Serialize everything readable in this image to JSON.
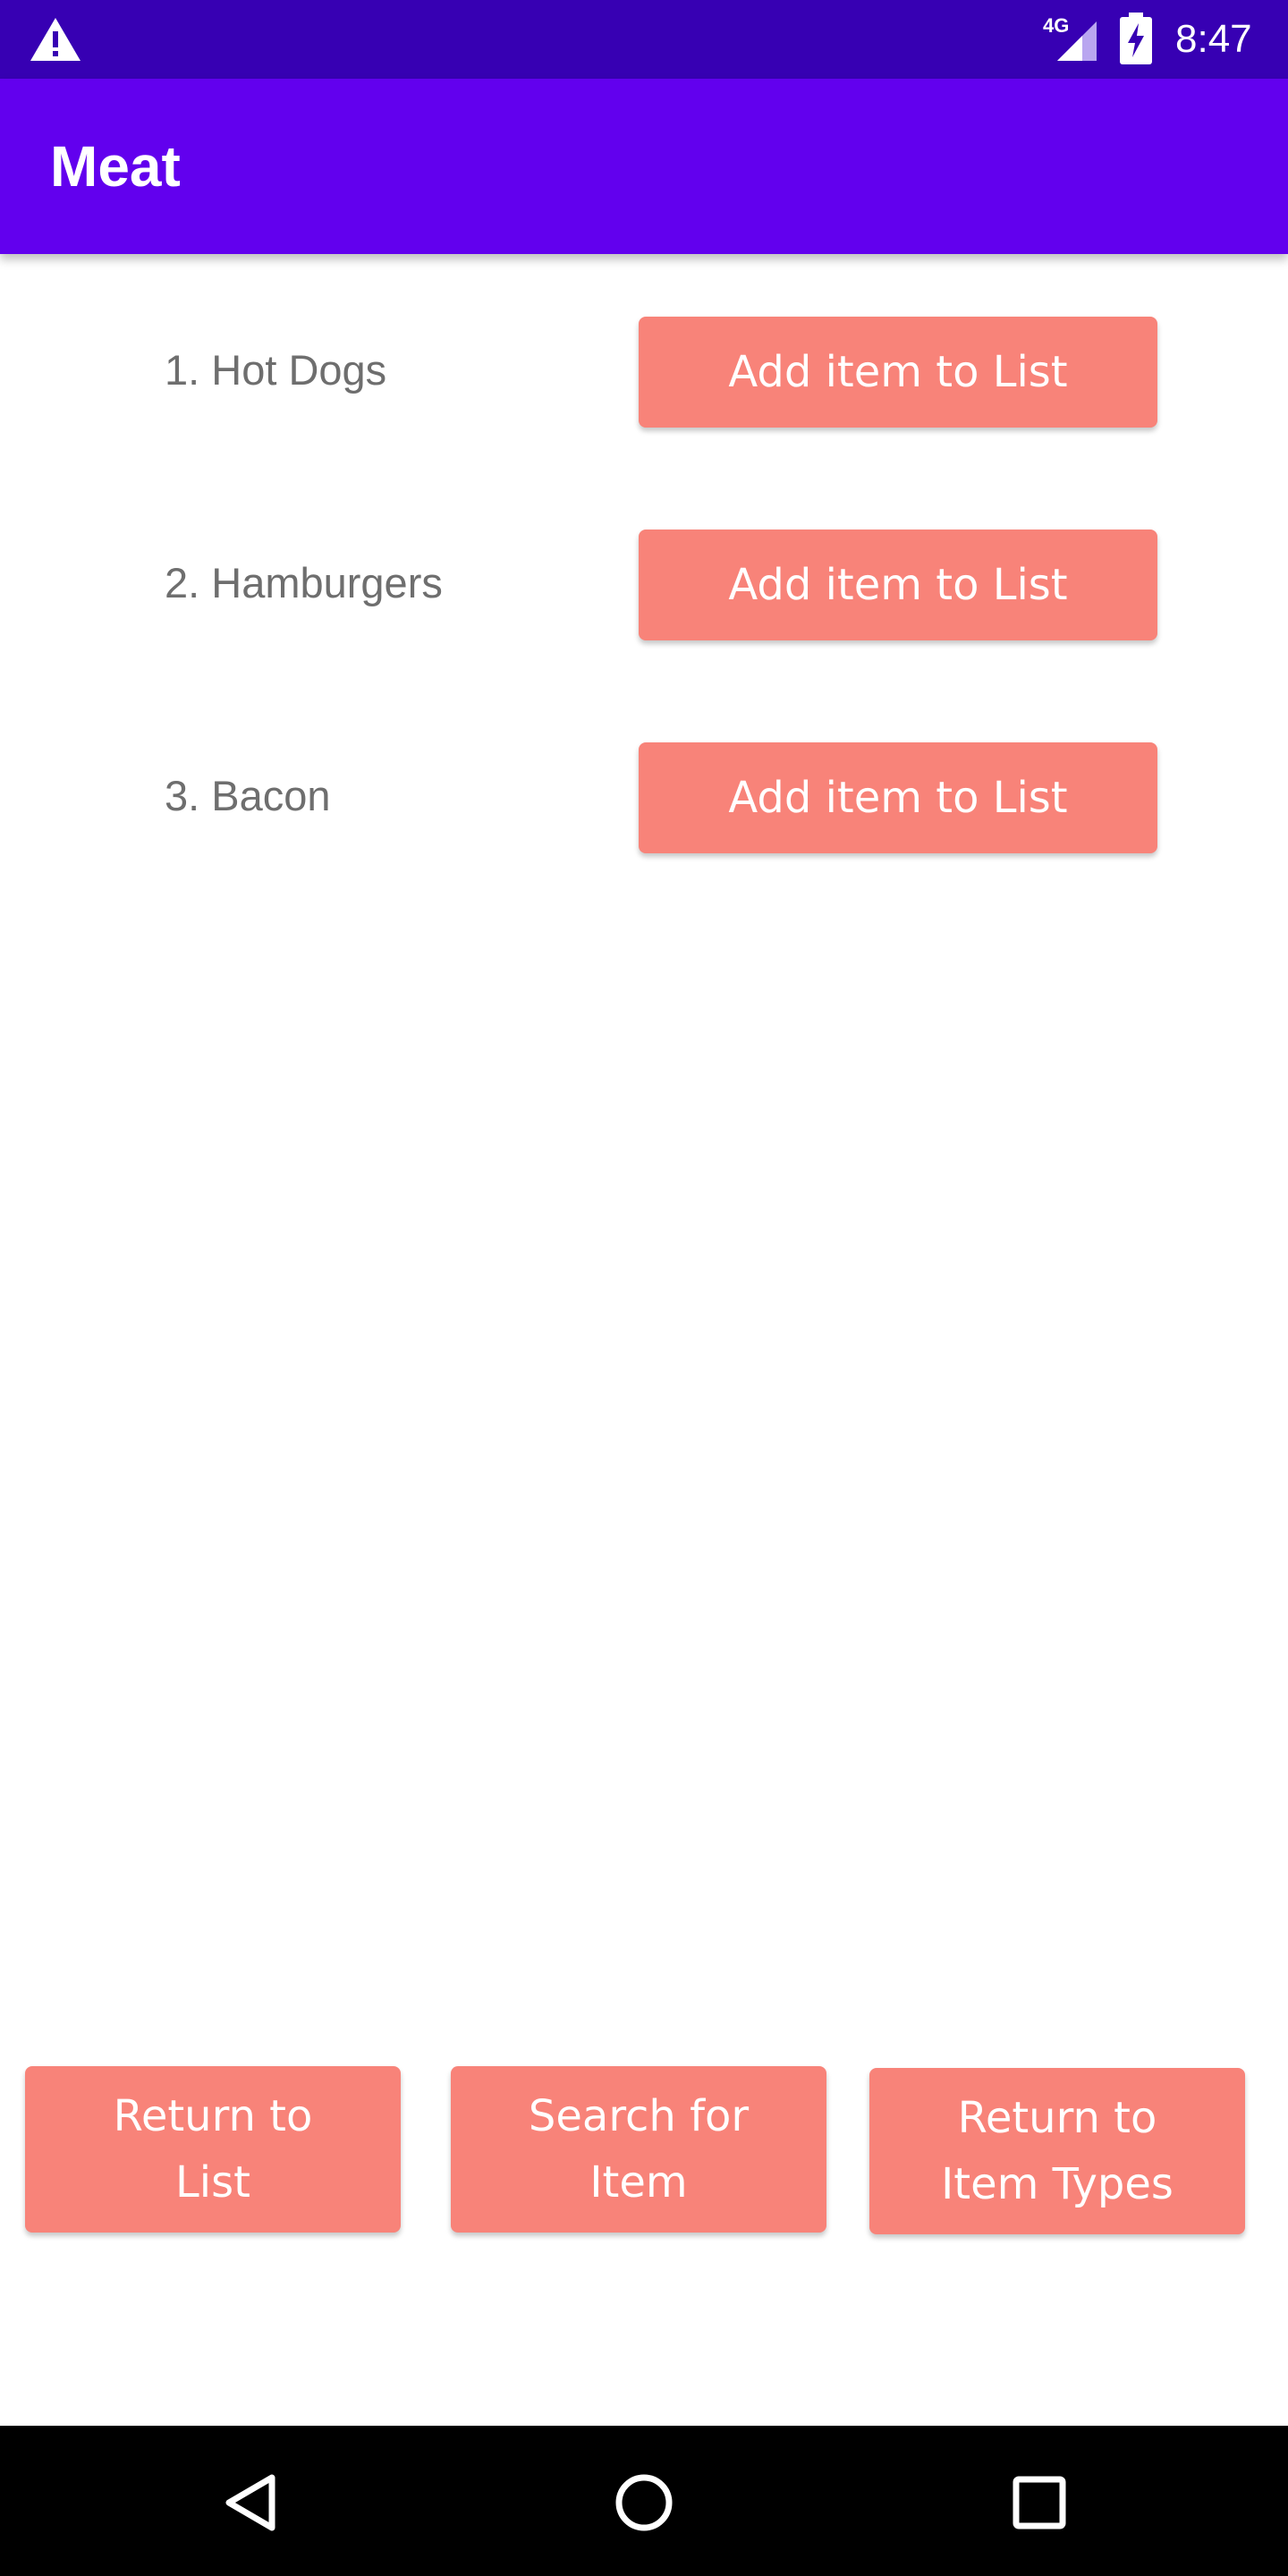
{
  "status_bar": {
    "time": "8:47",
    "network_type": "4G",
    "icons": [
      "warning-icon",
      "signal-icon",
      "battery-charging-icon"
    ]
  },
  "app_bar": {
    "title": "Meat"
  },
  "items": [
    {
      "label": "1. Hot Dogs",
      "button_label": "Add item to List"
    },
    {
      "label": "2. Hamburgers",
      "button_label": "Add item to List"
    },
    {
      "label": "3. Bacon",
      "button_label": "Add item to List"
    }
  ],
  "bottom_buttons": {
    "return_to_list": "Return to\nList",
    "search_for_item": "Search for\nItem",
    "return_to_item_types": "Return to\nItem Types"
  },
  "nav_bar": {
    "icons": [
      "back-icon",
      "home-icon",
      "recents-icon"
    ]
  },
  "colors": {
    "status_bar": "#3700b3",
    "app_bar": "#6200ee",
    "button": "#f88379",
    "label_text": "#6e6e6e"
  }
}
